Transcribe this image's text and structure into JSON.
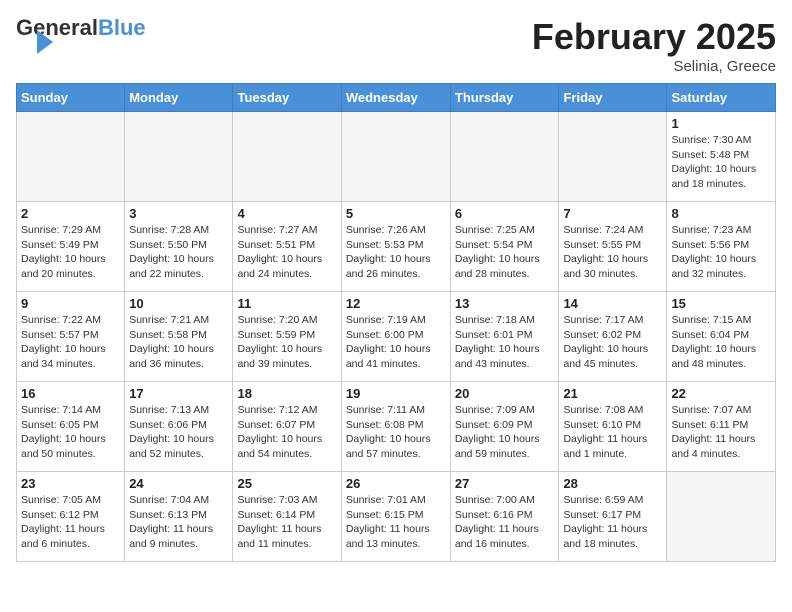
{
  "logo": {
    "general": "General",
    "blue": "Blue"
  },
  "title": "February 2025",
  "location": "Selinia, Greece",
  "days_of_week": [
    "Sunday",
    "Monday",
    "Tuesday",
    "Wednesday",
    "Thursday",
    "Friday",
    "Saturday"
  ],
  "weeks": [
    [
      {
        "day": "",
        "info": ""
      },
      {
        "day": "",
        "info": ""
      },
      {
        "day": "",
        "info": ""
      },
      {
        "day": "",
        "info": ""
      },
      {
        "day": "",
        "info": ""
      },
      {
        "day": "",
        "info": ""
      },
      {
        "day": "1",
        "info": "Sunrise: 7:30 AM\nSunset: 5:48 PM\nDaylight: 10 hours\nand 18 minutes."
      }
    ],
    [
      {
        "day": "2",
        "info": "Sunrise: 7:29 AM\nSunset: 5:49 PM\nDaylight: 10 hours\nand 20 minutes."
      },
      {
        "day": "3",
        "info": "Sunrise: 7:28 AM\nSunset: 5:50 PM\nDaylight: 10 hours\nand 22 minutes."
      },
      {
        "day": "4",
        "info": "Sunrise: 7:27 AM\nSunset: 5:51 PM\nDaylight: 10 hours\nand 24 minutes."
      },
      {
        "day": "5",
        "info": "Sunrise: 7:26 AM\nSunset: 5:53 PM\nDaylight: 10 hours\nand 26 minutes."
      },
      {
        "day": "6",
        "info": "Sunrise: 7:25 AM\nSunset: 5:54 PM\nDaylight: 10 hours\nand 28 minutes."
      },
      {
        "day": "7",
        "info": "Sunrise: 7:24 AM\nSunset: 5:55 PM\nDaylight: 10 hours\nand 30 minutes."
      },
      {
        "day": "8",
        "info": "Sunrise: 7:23 AM\nSunset: 5:56 PM\nDaylight: 10 hours\nand 32 minutes."
      }
    ],
    [
      {
        "day": "9",
        "info": "Sunrise: 7:22 AM\nSunset: 5:57 PM\nDaylight: 10 hours\nand 34 minutes."
      },
      {
        "day": "10",
        "info": "Sunrise: 7:21 AM\nSunset: 5:58 PM\nDaylight: 10 hours\nand 36 minutes."
      },
      {
        "day": "11",
        "info": "Sunrise: 7:20 AM\nSunset: 5:59 PM\nDaylight: 10 hours\nand 39 minutes."
      },
      {
        "day": "12",
        "info": "Sunrise: 7:19 AM\nSunset: 6:00 PM\nDaylight: 10 hours\nand 41 minutes."
      },
      {
        "day": "13",
        "info": "Sunrise: 7:18 AM\nSunset: 6:01 PM\nDaylight: 10 hours\nand 43 minutes."
      },
      {
        "day": "14",
        "info": "Sunrise: 7:17 AM\nSunset: 6:02 PM\nDaylight: 10 hours\nand 45 minutes."
      },
      {
        "day": "15",
        "info": "Sunrise: 7:15 AM\nSunset: 6:04 PM\nDaylight: 10 hours\nand 48 minutes."
      }
    ],
    [
      {
        "day": "16",
        "info": "Sunrise: 7:14 AM\nSunset: 6:05 PM\nDaylight: 10 hours\nand 50 minutes."
      },
      {
        "day": "17",
        "info": "Sunrise: 7:13 AM\nSunset: 6:06 PM\nDaylight: 10 hours\nand 52 minutes."
      },
      {
        "day": "18",
        "info": "Sunrise: 7:12 AM\nSunset: 6:07 PM\nDaylight: 10 hours\nand 54 minutes."
      },
      {
        "day": "19",
        "info": "Sunrise: 7:11 AM\nSunset: 6:08 PM\nDaylight: 10 hours\nand 57 minutes."
      },
      {
        "day": "20",
        "info": "Sunrise: 7:09 AM\nSunset: 6:09 PM\nDaylight: 10 hours\nand 59 minutes."
      },
      {
        "day": "21",
        "info": "Sunrise: 7:08 AM\nSunset: 6:10 PM\nDaylight: 11 hours\nand 1 minute."
      },
      {
        "day": "22",
        "info": "Sunrise: 7:07 AM\nSunset: 6:11 PM\nDaylight: 11 hours\nand 4 minutes."
      }
    ],
    [
      {
        "day": "23",
        "info": "Sunrise: 7:05 AM\nSunset: 6:12 PM\nDaylight: 11 hours\nand 6 minutes."
      },
      {
        "day": "24",
        "info": "Sunrise: 7:04 AM\nSunset: 6:13 PM\nDaylight: 11 hours\nand 9 minutes."
      },
      {
        "day": "25",
        "info": "Sunrise: 7:03 AM\nSunset: 6:14 PM\nDaylight: 11 hours\nand 11 minutes."
      },
      {
        "day": "26",
        "info": "Sunrise: 7:01 AM\nSunset: 6:15 PM\nDaylight: 11 hours\nand 13 minutes."
      },
      {
        "day": "27",
        "info": "Sunrise: 7:00 AM\nSunset: 6:16 PM\nDaylight: 11 hours\nand 16 minutes."
      },
      {
        "day": "28",
        "info": "Sunrise: 6:59 AM\nSunset: 6:17 PM\nDaylight: 11 hours\nand 18 minutes."
      },
      {
        "day": "",
        "info": ""
      }
    ]
  ]
}
